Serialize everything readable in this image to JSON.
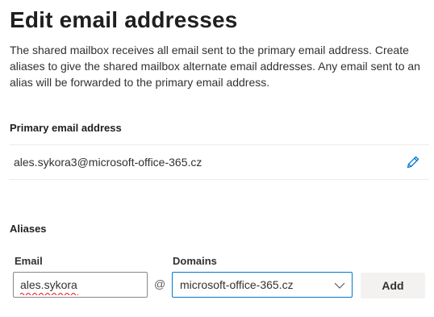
{
  "page": {
    "title": "Edit email addresses",
    "description": "The shared mailbox receives all email sent to the primary email address. Create aliases to give the shared mailbox alternate email addresses. Any email sent to an alias will be forwarded to the primary email address."
  },
  "primary": {
    "heading": "Primary email address",
    "email": "ales.sykora3@microsoft-office-365.cz",
    "edit_icon": "pencil-icon"
  },
  "aliases": {
    "heading": "Aliases",
    "email_label": "Email",
    "email_value": "ales.sykora",
    "at_symbol": "@",
    "domains_label": "Domains",
    "domain_selected": "microsoft-office-365.cz",
    "dropdown_icon": "chevron-down-icon",
    "add_label": "Add"
  },
  "colors": {
    "accent": "#0078d4",
    "spellcheck": "#e81123",
    "button_bg": "#f3f2f1"
  }
}
